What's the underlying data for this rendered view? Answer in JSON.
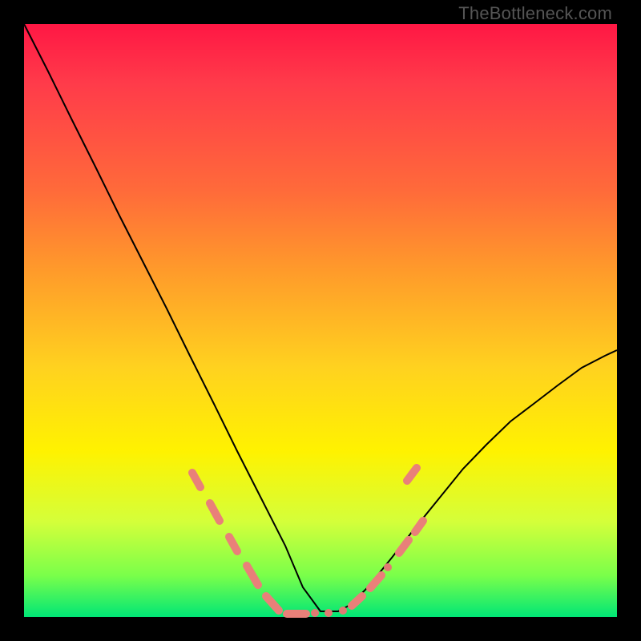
{
  "watermark": "TheBottleneck.com",
  "chart_data": {
    "type": "line",
    "title": "",
    "xlabel": "",
    "ylabel": "",
    "xlim": [
      0,
      100
    ],
    "ylim": [
      0,
      100
    ],
    "grid": false,
    "legend": false,
    "description": "V-shaped bottleneck curve over a red-to-green vertical gradient. Curve descends steeply from upper-left, reaches near-zero around x≈47–55, then rises with a gentler slope toward the right edge (reaching about y≈45 at x=100). Salmon-colored marker clusters highlight the curve segments on the lower flanks of the valley.",
    "series": [
      {
        "name": "bottleneck-curve",
        "x": [
          0,
          4,
          8,
          12,
          16,
          20,
          24,
          28,
          32,
          36,
          40,
          44,
          47,
          50,
          53,
          55,
          58,
          62,
          66,
          70,
          74,
          78,
          82,
          86,
          90,
          94,
          98,
          100
        ],
        "y": [
          100,
          92,
          84,
          76,
          68,
          60,
          52,
          44,
          36,
          28,
          20,
          12,
          5,
          1,
          1,
          2,
          5,
          10,
          15,
          20,
          25,
          29,
          33,
          36,
          39,
          42,
          44,
          45
        ]
      }
    ],
    "highlight_segments": [
      {
        "side": "left",
        "x_range": [
          28,
          47
        ],
        "note": "salmon markers on descending flank"
      },
      {
        "side": "right",
        "x_range": [
          55,
          68
        ],
        "note": "salmon markers on ascending flank"
      }
    ],
    "gradient_stops": [
      {
        "pos": 0.0,
        "color": "#ff1744"
      },
      {
        "pos": 0.28,
        "color": "#ff6a3a"
      },
      {
        "pos": 0.58,
        "color": "#ffd21f"
      },
      {
        "pos": 0.84,
        "color": "#d4ff3a"
      },
      {
        "pos": 1.0,
        "color": "#00e676"
      }
    ]
  }
}
